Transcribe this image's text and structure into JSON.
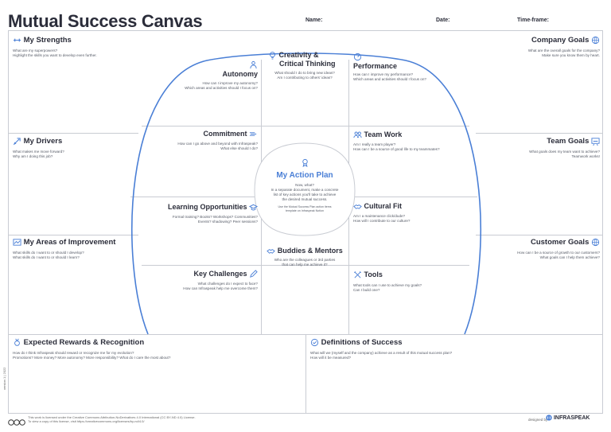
{
  "header": {
    "title": "Mutual Success Canvas",
    "name_label": "Name:",
    "date_label": "Date:",
    "timeframe_label": "Time-frame:"
  },
  "colors": {
    "accent": "#4a7fd6",
    "text": "#2b2d3a",
    "grid": "#c9ccd3"
  },
  "sections": {
    "strengths": {
      "title": "My Strengths",
      "desc1": "What are my superpowers?",
      "desc2": "Highlight the skills you want to develop even further.",
      "icon": "strength-icon"
    },
    "drivers": {
      "title": "My Drivers",
      "desc1": "What makes me move forward?",
      "desc2": "Why am I doing this job?",
      "icon": "rocket-icon"
    },
    "improvement": {
      "title": "My Areas of Improvement",
      "desc1": "What skills do I want to or should I develop?",
      "desc2": "What skills do I want to or should I learn?",
      "icon": "chart-icon"
    },
    "company_goals": {
      "title": "Company Goals",
      "desc1": "What are the overall goals for the company?",
      "desc2": "Make sure you know them by heart.",
      "icon": "globe-icon"
    },
    "team_goals": {
      "title": "Team Goals",
      "desc1": "What goals does my team want to achieve?",
      "desc2": "Teamwork works!",
      "icon": "board-icon"
    },
    "customer_goals": {
      "title": "Customer Goals",
      "desc1": "How can I be a source of growth to our customers?",
      "desc2": "What goals can I help them achieve?",
      "icon": "globe-icon"
    },
    "autonomy": {
      "title": "Autonomy",
      "desc1": "How can I improve my autonomy?",
      "desc2": "Which areas and activities should I focus on?",
      "icon": "person-icon"
    },
    "commitment": {
      "title": "Commitment",
      "desc1": "How can I go above and beyond with Infraspeak?",
      "desc2": "What else should I do?",
      "icon": "speed-icon"
    },
    "learning": {
      "title": "Learning Opportunities",
      "desc1": "Formal training? Books? Workshops? Communities?",
      "desc2": "Events? shadowing? Peer sessions?",
      "icon": "cap-icon"
    },
    "challenges": {
      "title": "Key Challenges",
      "desc1": "What challenges do I expect to face?",
      "desc2": "How can Infraspeak help me overcome them?",
      "icon": "pencil-icon"
    },
    "creativity": {
      "title_1": "Creativity &",
      "title_2": "Critical Thinking",
      "desc1": "What should I do to bring new ideas?",
      "desc2": "Am I contributing to others' ideas?",
      "icon": "bulb-icon"
    },
    "performance": {
      "title": "Performance",
      "desc1": "How can I improve my performance?",
      "desc2": "Which areas and activities should I focus on?",
      "icon": "gauge-icon"
    },
    "teamwork": {
      "title": "Team Work",
      "desc1": "Am I really a team player?",
      "desc2": "How can I be a source of good life to my teammates?",
      "icon": "people-icon"
    },
    "cultural_fit": {
      "title": "Cultural Fit",
      "desc1": "Am I a maintenance click/dude?",
      "desc2": "How will I contribute to our culture?",
      "icon": "handshake-icon"
    },
    "buddies": {
      "title": "Buddies & Mentors",
      "desc1": "Who are the colleagues or 3rd parties",
      "desc2": "that can help me achieve it?",
      "icon": "handshake-icon"
    },
    "tools": {
      "title": "Tools",
      "desc1": "What tools can I use to achieve my goals?",
      "desc2": "Can I build one?",
      "icon": "tools-icon"
    },
    "action_plan": {
      "title": "My Action Plan",
      "desc1": "Now, what?",
      "desc2": "In a separate document, make a concrete",
      "desc3": "list of key actions you'll take to achieve",
      "desc4": "the desired mutual success.",
      "note1": "Use the Mutual Success Plan action items",
      "note2": "template on Infraspeak Notion",
      "icon": "award-icon"
    },
    "rewards": {
      "title": "Expected Rewards & Recognition",
      "desc1": "How do I think Infraspeak should reward or recognize me for my evolution?",
      "desc2": "Promotions? More money? More autonomy? More responsibility? What do I care the most about?",
      "icon": "medal-icon"
    },
    "definitions": {
      "title": "Definitions of Success",
      "desc1": "What will we (myself and the company) achieve as a result of this mutual success plan?",
      "desc2": "How will it be measured?",
      "icon": "check-icon"
    }
  },
  "footer": {
    "license": "This work is licensed under the Creative Commons Attribution-NoDerivatives 4.0 International (CC BY-ND 4.0) License.",
    "license2": "To view a copy of this license, visit https://creativecommons.org/licenses/by-nd/4.0/",
    "designed_by": "designed by",
    "brand": "INFRASPEAK",
    "side": "version 1 | 2022"
  }
}
